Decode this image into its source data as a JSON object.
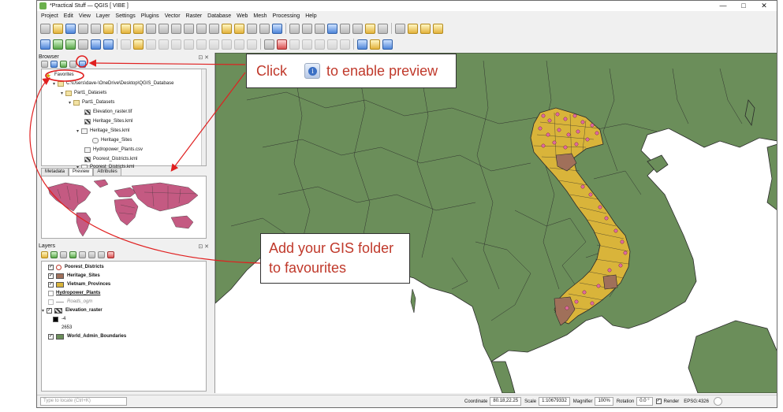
{
  "window": {
    "title": "*Practical Stuff — QGIS [ VIBE ]",
    "minimize": "—",
    "maximize": "□",
    "close": "✕"
  },
  "menu": [
    "Project",
    "Edit",
    "View",
    "Layer",
    "Settings",
    "Plugins",
    "Vector",
    "Raster",
    "Database",
    "Web",
    "Mesh",
    "Processing",
    "Help"
  ],
  "browser": {
    "title": "Browser",
    "panel_controls": "⊡ ✕",
    "tree": [
      {
        "label": "Favorites",
        "icon": "star-icon"
      },
      {
        "label": "C:\\Users\\dave-\\OneDrive\\Desktop\\QGIS_Database",
        "icon": "folder-icon"
      },
      {
        "label": "Part1_Datasets",
        "icon": "folder-icon"
      },
      {
        "label": "Part1_Datasets",
        "icon": "folder-icon"
      },
      {
        "label": "Elevation_raster.tif",
        "icon": "raster-icon"
      },
      {
        "label": "Heritage_Sites.kml",
        "icon": "raster-icon"
      },
      {
        "label": "Heritage_Sites.kml",
        "icon": "file-icon"
      },
      {
        "label": "Heritage_Sites",
        "icon": "layer-icon"
      },
      {
        "label": "Hydropower_Plants.csv",
        "icon": "file-icon"
      },
      {
        "label": "Poorest_Districts.kml",
        "icon": "raster-icon"
      },
      {
        "label": "Poorest_Districts.kml",
        "icon": "file-icon"
      }
    ],
    "tabs": [
      "Metadata",
      "Preview",
      "Attributes"
    ],
    "active_tab": "Preview"
  },
  "layers": {
    "title": "Layers",
    "panel_controls": "⊡ ✕",
    "items": [
      {
        "label": "Poorest_Districts",
        "checked": true,
        "swatch": "#ffffff",
        "bold": true
      },
      {
        "label": "Heritage_Sites",
        "checked": true,
        "swatch": "#a0705a",
        "bold": true
      },
      {
        "label": "Vietnam_Provinces",
        "checked": true,
        "swatch": "#d9b43a",
        "bold": true
      },
      {
        "label": "Hydropower_Plants",
        "checked": false,
        "swatch": "#dddddd",
        "bold": true
      },
      {
        "label": "Roads_ogm",
        "checked": false,
        "swatch": "#ffffff",
        "bold": false
      },
      {
        "label": "Elevation_raster",
        "checked": true,
        "swatch": "#444444",
        "bold": true
      },
      {
        "label": "-4",
        "checked": null,
        "swatch": "#000000",
        "bold": false
      },
      {
        "label": "2653",
        "checked": null,
        "swatch": "#ffffff",
        "bold": false
      },
      {
        "label": "World_Admin_Boundaries",
        "checked": true,
        "swatch": "#6b8e5a",
        "bold": true
      }
    ]
  },
  "status": {
    "locate_placeholder": "Type to locate (Ctrl+K)",
    "coordinate_label": "Coordinate",
    "coordinate_value": "80.18,22.25",
    "scale_label": "Scale",
    "scale_value": "1:10679332",
    "magnifier_label": "Magnifier",
    "magnifier_value": "100%",
    "rotation_label": "Rotation",
    "rotation_value": "0.0 °",
    "render_label": "Render",
    "crs": "EPSG:4326"
  },
  "callouts": {
    "preview_prefix": "Click",
    "preview_suffix": "to enable preview",
    "favourites_line1": "Add your GIS folder",
    "favourites_line2": "to favourites"
  },
  "colors": {
    "land": "#6b8e5a",
    "vietnam": "#d9b43a",
    "poorest": "#a0705a",
    "heritage": "#e06aa0",
    "annotation_red": "#e02020"
  }
}
